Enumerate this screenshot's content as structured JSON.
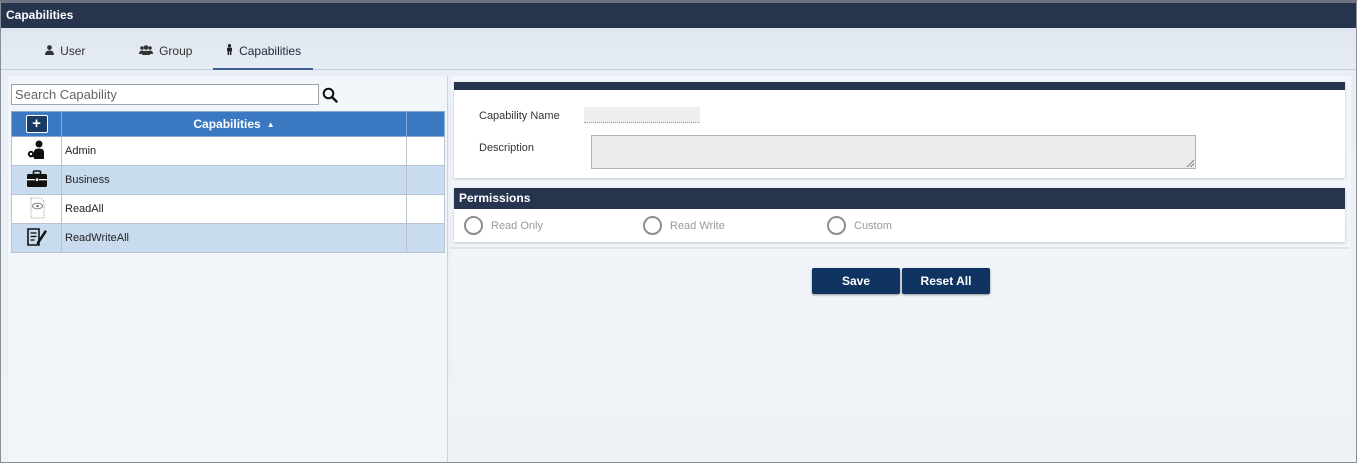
{
  "window": {
    "title": "Capabilities"
  },
  "tabs": [
    {
      "label": "User",
      "icon": "user-icon"
    },
    {
      "label": "Group",
      "icon": "group-icon"
    },
    {
      "label": "Capabilities",
      "icon": "person-icon",
      "active": true
    }
  ],
  "search": {
    "placeholder": "Search Capability",
    "value": ""
  },
  "grid": {
    "add_label": "+",
    "header": "Capabilities",
    "sort": "ascending",
    "rows": [
      {
        "name": "Admin",
        "icon": "admin-icon"
      },
      {
        "name": "Business",
        "icon": "briefcase-icon"
      },
      {
        "name": "ReadAll",
        "icon": "eye-document-icon"
      },
      {
        "name": "ReadWriteAll",
        "icon": "edit-document-icon"
      }
    ]
  },
  "form": {
    "capability_name_label": "Capability Name",
    "capability_name_value": "",
    "description_label": "Description",
    "description_value": ""
  },
  "permissions": {
    "title": "Permissions",
    "options": [
      "Read Only",
      "Read Write",
      "Custom"
    ]
  },
  "actions": {
    "save_label": "Save",
    "reset_label": "Reset All"
  },
  "colors": {
    "dark_navy": "#26344d",
    "header_blue": "#3a78c2",
    "button_navy": "#0f3461",
    "row_alt": "#c9dbef"
  }
}
